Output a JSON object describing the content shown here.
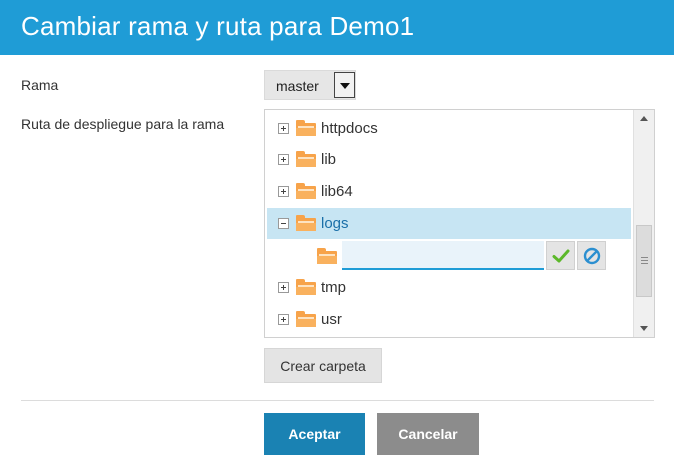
{
  "dialog": {
    "title": "Cambiar rama y ruta para Demo1"
  },
  "form": {
    "branch_label": "Rama",
    "branch_value": "master",
    "path_label": "Ruta de despliegue para la rama"
  },
  "tree": {
    "items": [
      {
        "label": "httpdocs",
        "expander": "plus",
        "selected": false
      },
      {
        "label": "lib",
        "expander": "plus",
        "selected": false
      },
      {
        "label": "lib64",
        "expander": "plus",
        "selected": false
      },
      {
        "label": "logs",
        "expander": "minus",
        "selected": true
      },
      {
        "label": "tmp",
        "expander": "plus",
        "selected": false
      },
      {
        "label": "usr",
        "expander": "plus",
        "selected": false
      }
    ],
    "new_folder_value": ""
  },
  "buttons": {
    "create_folder": "Crear carpeta",
    "accept": "Aceptar",
    "cancel": "Cancelar"
  },
  "colors": {
    "title_bar": "#1f9cd6",
    "accept": "#1a82b3",
    "cancel": "#8c8c8c",
    "folder": "#f7a34a",
    "selection": "#c7e5f3"
  },
  "icons": {
    "folder": "folder-icon",
    "confirm": "checkmark-icon",
    "cancel": "prohibited-icon"
  }
}
